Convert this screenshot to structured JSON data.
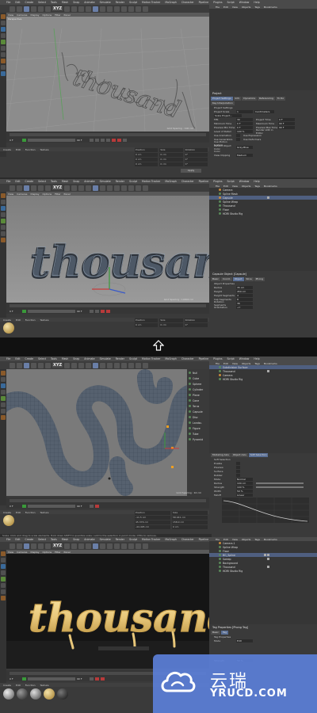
{
  "menus": {
    "panel1": [
      "File",
      "Edit",
      "View",
      "Objects",
      "Tags",
      "Bookmarks"
    ],
    "main": [
      "File",
      "Edit",
      "Create",
      "Select",
      "Tools",
      "Mesh",
      "Snap",
      "Animate",
      "Simulate",
      "Render",
      "Sculpt",
      "Motion Tracker",
      "MoGraph",
      "Character",
      "Pipeline",
      "Plugins",
      "Script",
      "Window",
      "Help"
    ],
    "viewport": [
      "View",
      "Cameras",
      "Display",
      "Options",
      "Filter",
      "Panel"
    ],
    "timeline": [
      "Create",
      "Edit",
      "Function",
      "Texture"
    ],
    "right_tabs_label": "Startup (User)"
  },
  "layout_label": "Layout",
  "viewport_label": "Perspective",
  "grid_spacing": [
    "Grid Spacing : 100 cm",
    "Grid Spacing : 10000 cm",
    "Grid Spacing : 10 cm"
  ],
  "coords": {
    "headers": [
      "Position",
      "Size",
      "Rotation"
    ],
    "rows": [
      [
        "X",
        "0 cm",
        "X",
        "0 cm",
        "H",
        "0°"
      ],
      [
        "Y",
        "0 cm",
        "Y",
        "0 cm",
        "P",
        "0°"
      ],
      [
        "Z",
        "0 cm",
        "Z",
        "0 cm",
        "B",
        "0°"
      ]
    ],
    "mode": [
      "Object (Rel)",
      "Size"
    ],
    "apply": "Apply",
    "panel3_rows": [
      [
        "X",
        "-11.5 cm",
        "X",
        "58.041 cm"
      ],
      [
        "Y",
        "45.376 cm",
        "Y",
        "158.0 cm"
      ],
      [
        "Z",
        "-44.495 cm",
        "Z",
        "0 cm"
      ]
    ]
  },
  "timeline": {
    "frame_start": "0 F",
    "frame_end": "90 F",
    "frame_cur": "0 F"
  },
  "panel1": {
    "attr_title": "Project",
    "attr_tabs": [
      "Project Settings",
      "Info",
      "Dynamics",
      "Referencing",
      "To Do"
    ],
    "attr_subtabs": [
      "Key Interpolation"
    ],
    "section": "Project Settings",
    "props": [
      [
        "Project Scale",
        "1",
        "Centimeters"
      ],
      [
        "Scale Project..."
      ],
      [
        "FPS",
        "30",
        "Project Time",
        "0 F"
      ],
      [
        "Minimum Time",
        "0 F",
        "Maximum Time",
        "90 F"
      ],
      [
        "Preview Min Time",
        "0 F",
        "Preview Max Time",
        "90 F"
      ],
      [
        "Level of Detail",
        "100 %",
        "Render LOD in Editor",
        ""
      ],
      [
        "Use Animation",
        "",
        "Use Expression",
        ""
      ],
      [
        "Use Generators",
        "",
        "Use Deformers",
        ""
      ],
      [
        "Use Motion System",
        ""
      ],
      [
        "Default Object Color",
        "Gray-Blue"
      ],
      [
        "Color",
        ""
      ],
      [
        "View Clipping",
        "Medium"
      ],
      [
        "Linear Workflow",
        ""
      ]
    ]
  },
  "panel2": {
    "objects": [
      {
        "name": "Camera",
        "dot": "o"
      },
      {
        "name": "Spline Mask",
        "dot": "g"
      },
      {
        "name": "Capsule",
        "dot": "o"
      },
      {
        "name": "Spline Wrap",
        "dot": "g"
      },
      {
        "name": "Thousand",
        "dot": "g"
      },
      {
        "name": "Floor",
        "dot": "g"
      },
      {
        "name": "HDRI Studio Rig",
        "dot": "g"
      }
    ],
    "attr_title": "Capsule Object [Capsule]",
    "attr_tabs": [
      "Basic",
      "Coord.",
      "Object",
      "Slice",
      "Phong"
    ],
    "section": "Object Properties",
    "props": [
      [
        "Radius",
        "35 cm"
      ],
      [
        "Height",
        "450 cm"
      ],
      [
        "Height Segments",
        "4"
      ],
      [
        "Cap Segments",
        "8"
      ],
      [
        "Rotation Segments",
        "36"
      ],
      [
        "Orientation",
        "+Y"
      ]
    ]
  },
  "panel3": {
    "objects": [
      {
        "name": "Subdivision Surface",
        "dot": "g",
        "sel": true
      },
      {
        "name": "Thousand",
        "dot": "g"
      },
      {
        "name": "Camera",
        "dot": "o"
      },
      {
        "name": "HDRI Studio Rig",
        "dot": "g"
      }
    ],
    "tools": [
      "Null",
      "Cube",
      "Sphere",
      "Cylinder",
      "Plane",
      "Cone",
      "Torus",
      "Capsule",
      "Disc",
      "Landsc.",
      "Figure",
      "Tube",
      "Pyramid"
    ],
    "attr_tabs": [
      "Modeling Axis",
      "Object Axis",
      "Soft Selection"
    ],
    "section": "Soft Selection",
    "props": [
      [
        "Enable",
        ""
      ],
      [
        "Preview",
        ""
      ],
      [
        "Surface",
        ""
      ],
      [
        "Rubber",
        ""
      ],
      [
        "Mode",
        "Normal"
      ],
      [
        "Radius",
        "100 cm"
      ],
      [
        "Strength",
        "100 %"
      ],
      [
        "Width",
        "50 %"
      ],
      [
        "Falloff",
        "Linear"
      ]
    ]
  },
  "panel4": {
    "objects": [
      {
        "name": "Camera.1",
        "dot": "o"
      },
      {
        "name": "Spline Wrap",
        "dot": "g"
      },
      {
        "name": "Floor",
        "dot": "g"
      },
      {
        "name": "BG_Spline",
        "dot": "g",
        "sel": true
      },
      {
        "name": "Sweep",
        "dot": "g"
      },
      {
        "name": "Background",
        "dot": "g"
      },
      {
        "name": "Thousand",
        "dot": "g"
      },
      {
        "name": "HDRI Studio Rig",
        "dot": "g"
      }
    ],
    "attr_title": "Tag Properties [Phong Tag]",
    "attr_tabs": [
      "Basic",
      "Tag"
    ],
    "section": "Tag Properties",
    "props": [
      [
        "Mode",
        "Edit"
      ],
      [
        "Strength",
        "50 %"
      ]
    ],
    "status": "Scale: Click and drag to scale elements. Hold down SHIFT to quantize scale / add to the selection in point mode; CTRL to remove."
  },
  "watermark": {
    "cn": "云瑞",
    "en": "YRUCD.COM"
  },
  "lettering": "thousand",
  "colors": {
    "viewport1": "#8c8c8c",
    "viewport2": "#8a8a8a",
    "viewport3": "#7d7d7d",
    "viewport4": "#141414",
    "watermark": "#5b7fd8",
    "gold": "#e8c77a",
    "tube": "#5d6a78"
  }
}
